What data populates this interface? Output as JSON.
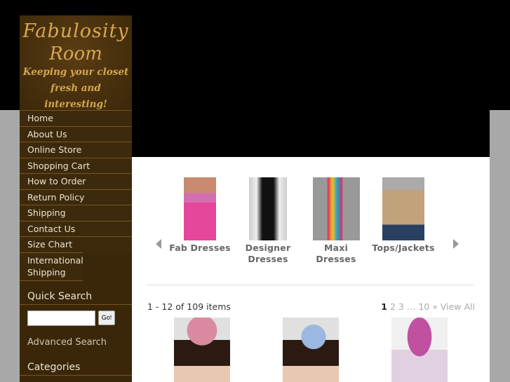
{
  "logo": {
    "line1": "Fabulosity",
    "line2": "Room",
    "line3": "Keeping your closet",
    "line4": "fresh and interesting!"
  },
  "nav": [
    "Home",
    "About Us",
    "Online Store",
    "Shopping Cart",
    "How to Order",
    "Return Policy",
    "Shipping",
    "Contact Us",
    "Size Chart",
    "International Shipping"
  ],
  "quick_search": {
    "title": "Quick Search",
    "value": "",
    "go": "Go!",
    "advanced": "Advanced Search"
  },
  "categories_title": "Categories",
  "carousel": [
    {
      "label": "Fab Dresses"
    },
    {
      "label": "Designer Dresses"
    },
    {
      "label": "Maxi Dresses"
    },
    {
      "label": "Tops/Jackets"
    }
  ],
  "listing": {
    "count": "1 - 12 of 109 items",
    "pages": {
      "current": "1",
      "p2": "2",
      "p3": "3",
      "ellipsis": "…",
      "last": "10",
      "next": "»",
      "view_all": "View All"
    }
  }
}
